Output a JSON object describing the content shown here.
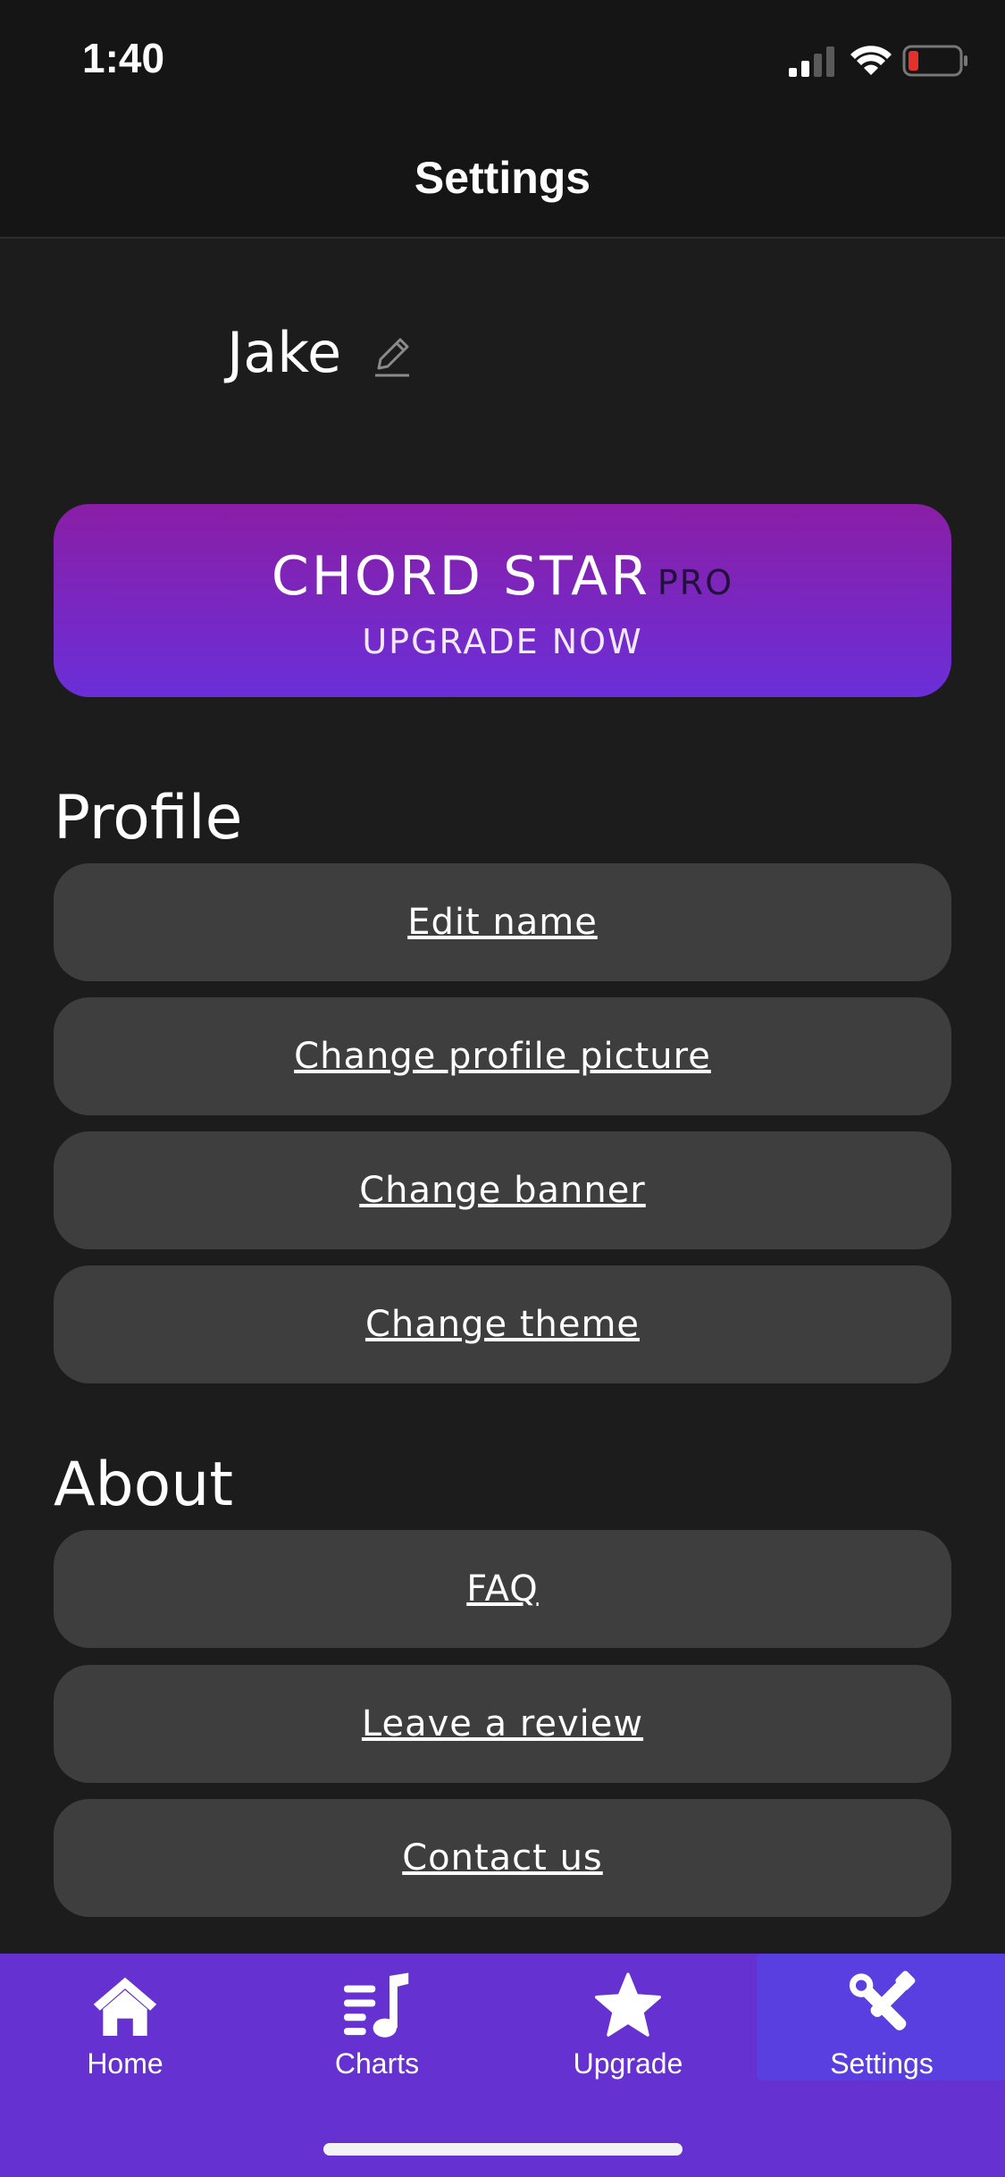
{
  "status_bar": {
    "time": "1:40"
  },
  "header": {
    "title": "Settings"
  },
  "profile": {
    "name": "Jake"
  },
  "pro_banner": {
    "title": "CHORD STAR",
    "badge": "PRO",
    "subtitle": "UPGRADE NOW"
  },
  "sections": {
    "profile": {
      "heading": "Profile",
      "items": [
        "Edit name",
        "Change profile picture",
        "Change banner",
        "Change theme"
      ]
    },
    "about": {
      "heading": "About",
      "items": [
        "FAQ",
        "Leave a review",
        "Contact us"
      ]
    }
  },
  "tab_bar": {
    "tabs": [
      {
        "label": "Home",
        "icon": "home-icon"
      },
      {
        "label": "Charts",
        "icon": "music-list-icon"
      },
      {
        "label": "Upgrade",
        "icon": "star-icon"
      },
      {
        "label": "Settings",
        "icon": "tools-icon"
      }
    ],
    "active": "Settings"
  },
  "colors": {
    "background": "#1c1c1c",
    "tab_bar": "#6531d1",
    "banner_gradient_top": "#8a1ea6",
    "banner_gradient_bottom": "#6a2fd8",
    "button": "#3e3e3e"
  }
}
